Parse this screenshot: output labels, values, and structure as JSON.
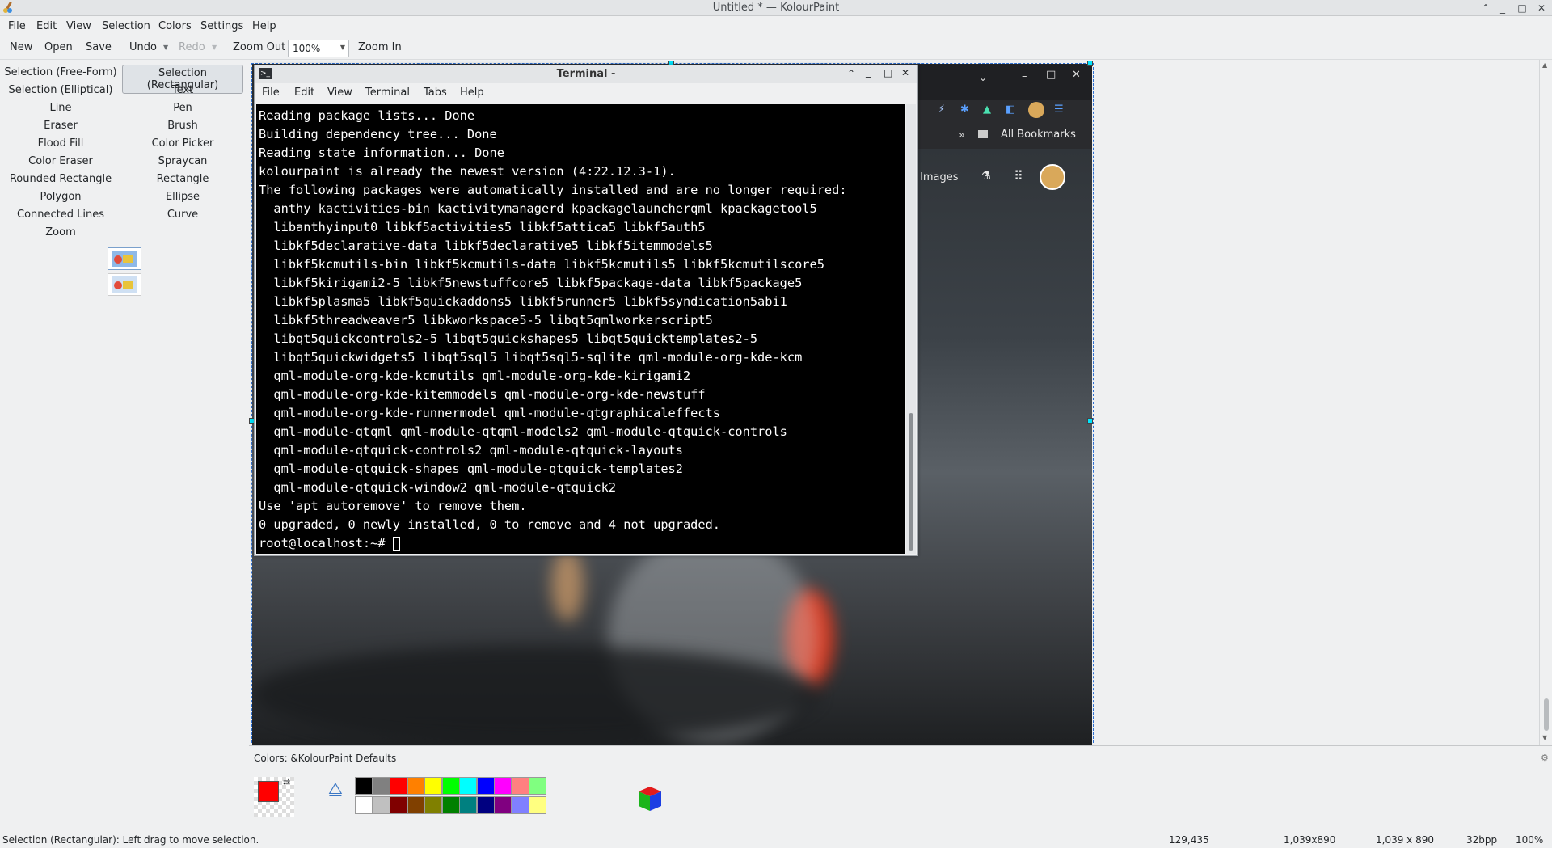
{
  "window": {
    "title": "Untitled * — KolourPaint"
  },
  "menubar": [
    "File",
    "Edit",
    "View",
    "Selection",
    "Colors",
    "Settings",
    "Help"
  ],
  "toolbar": {
    "new": "New",
    "open": "Open",
    "save": "Save",
    "undo": "Undo",
    "redo": "Redo",
    "zoom_out": "Zoom Out",
    "zoom_value": "100%",
    "zoom_in": "Zoom In"
  },
  "tools": [
    "Selection (Free-Form)",
    "Selection (Rectangular)",
    "Selection (Elliptical)",
    "Text",
    "Line",
    "Pen",
    "Eraser",
    "Brush",
    "Flood Fill",
    "Color Picker",
    "Color Eraser",
    "Spraycan",
    "Rounded Rectangle",
    "Rectangle",
    "Polygon",
    "Ellipse",
    "Connected Lines",
    "Curve",
    "Zoom"
  ],
  "terminal": {
    "title": "Terminal -",
    "menu": [
      "File",
      "Edit",
      "View",
      "Terminal",
      "Tabs",
      "Help"
    ],
    "lines": [
      "Reading package lists... Done",
      "Building dependency tree... Done",
      "Reading state information... Done",
      "kolourpaint is already the newest version (4:22.12.3-1).",
      "The following packages were automatically installed and are no longer required:",
      "  anthy kactivities-bin kactivitymanagerd kpackagelauncherqml kpackagetool5",
      "  libanthyinput0 libkf5activities5 libkf5attica5 libkf5auth5",
      "  libkf5declarative-data libkf5declarative5 libkf5itemmodels5",
      "  libkf5kcmutils-bin libkf5kcmutils-data libkf5kcmutils5 libkf5kcmutilscore5",
      "  libkf5kirigami2-5 libkf5newstuffcore5 libkf5package-data libkf5package5",
      "  libkf5plasma5 libkf5quickaddons5 libkf5runner5 libkf5syndication5abi1",
      "  libkf5threadweaver5 libkworkspace5-5 libqt5qmlworkerscript5",
      "  libqt5quickcontrols2-5 libqt5quickshapes5 libqt5quicktemplates2-5",
      "  libqt5quickwidgets5 libqt5sql5 libqt5sql5-sqlite qml-module-org-kde-kcm",
      "  qml-module-org-kde-kcmutils qml-module-org-kde-kirigami2",
      "  qml-module-org-kde-kitemmodels qml-module-org-kde-newstuff",
      "  qml-module-org-kde-runnermodel qml-module-qtgraphicaleffects",
      "  qml-module-qtqml qml-module-qtqml-models2 qml-module-qtquick-controls",
      "  qml-module-qtquick-controls2 qml-module-qtquick-layouts",
      "  qml-module-qtquick-shapes qml-module-qtquick-templates2",
      "  qml-module-qtquick-window2 qml-module-qtquick2",
      "Use 'apt autoremove' to remove them.",
      "0 upgraded, 0 newly installed, 0 to remove and 4 not upgraded.",
      "root@localhost:~# "
    ]
  },
  "browser": {
    "bookmarks": "All Bookmarks",
    "images_link": "Images"
  },
  "colors": {
    "label": "Colors: &KolourPaint Defaults",
    "foreground": "#ff0000",
    "background": "#ffffff",
    "palette_top": [
      "#000000",
      "#808080",
      "#ff0000",
      "#ff8000",
      "#ffff00",
      "#00ff00",
      "#00ffff",
      "#0000ff",
      "#ff00ff",
      "#ff8080",
      "#80ff80"
    ],
    "palette_bottom": [
      "#ffffff",
      "#c0c0c0",
      "#800000",
      "#804000",
      "#808000",
      "#008000",
      "#008080",
      "#000080",
      "#800080",
      "#8080ff",
      "#ffff80"
    ]
  },
  "status": {
    "message": "Selection (Rectangular): Left drag to move selection.",
    "coords": "129,435",
    "selection_size": "1,039x890",
    "image_size": "1,039 x 890",
    "depth": "32bpp",
    "zoom": "100%"
  }
}
